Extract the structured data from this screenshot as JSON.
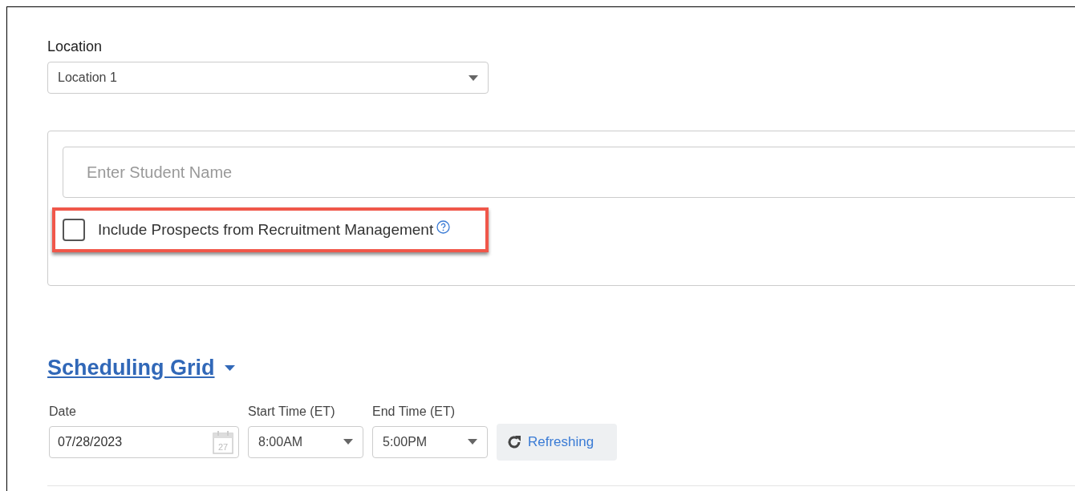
{
  "location": {
    "label": "Location",
    "value": "Location 1"
  },
  "student_search": {
    "placeholder": "Enter Student Name",
    "include_prospects": {
      "label": "Include Prospects from Recruitment Management",
      "checked": false
    }
  },
  "scheduling_grid": {
    "title": "Scheduling Grid",
    "expanded": true,
    "date": {
      "label": "Date",
      "value": "07/28/2023",
      "calendar_day": "27"
    },
    "start_time": {
      "label": "Start Time (ET)",
      "value": "8:00AM"
    },
    "end_time": {
      "label": "End Time (ET)",
      "value": "5:00PM"
    },
    "refresh_button": {
      "label": "Refreshing"
    }
  }
}
